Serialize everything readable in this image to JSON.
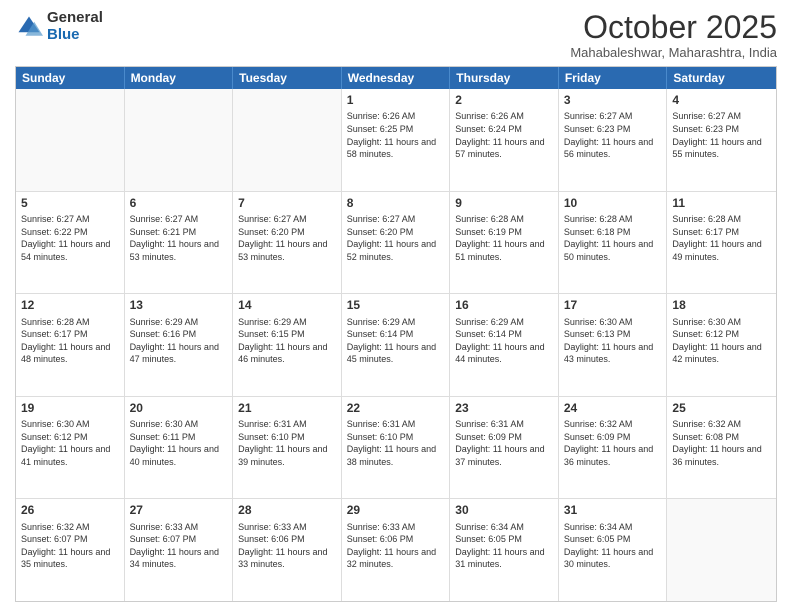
{
  "logo": {
    "general": "General",
    "blue": "Blue"
  },
  "title": "October 2025",
  "location": "Mahabaleshwar, Maharashtra, India",
  "headers": [
    "Sunday",
    "Monday",
    "Tuesday",
    "Wednesday",
    "Thursday",
    "Friday",
    "Saturday"
  ],
  "weeks": [
    [
      {
        "day": "",
        "sunrise": "",
        "sunset": "",
        "daylight": ""
      },
      {
        "day": "",
        "sunrise": "",
        "sunset": "",
        "daylight": ""
      },
      {
        "day": "",
        "sunrise": "",
        "sunset": "",
        "daylight": ""
      },
      {
        "day": "1",
        "sunrise": "Sunrise: 6:26 AM",
        "sunset": "Sunset: 6:25 PM",
        "daylight": "Daylight: 11 hours and 58 minutes."
      },
      {
        "day": "2",
        "sunrise": "Sunrise: 6:26 AM",
        "sunset": "Sunset: 6:24 PM",
        "daylight": "Daylight: 11 hours and 57 minutes."
      },
      {
        "day": "3",
        "sunrise": "Sunrise: 6:27 AM",
        "sunset": "Sunset: 6:23 PM",
        "daylight": "Daylight: 11 hours and 56 minutes."
      },
      {
        "day": "4",
        "sunrise": "Sunrise: 6:27 AM",
        "sunset": "Sunset: 6:23 PM",
        "daylight": "Daylight: 11 hours and 55 minutes."
      }
    ],
    [
      {
        "day": "5",
        "sunrise": "Sunrise: 6:27 AM",
        "sunset": "Sunset: 6:22 PM",
        "daylight": "Daylight: 11 hours and 54 minutes."
      },
      {
        "day": "6",
        "sunrise": "Sunrise: 6:27 AM",
        "sunset": "Sunset: 6:21 PM",
        "daylight": "Daylight: 11 hours and 53 minutes."
      },
      {
        "day": "7",
        "sunrise": "Sunrise: 6:27 AM",
        "sunset": "Sunset: 6:20 PM",
        "daylight": "Daylight: 11 hours and 53 minutes."
      },
      {
        "day": "8",
        "sunrise": "Sunrise: 6:27 AM",
        "sunset": "Sunset: 6:20 PM",
        "daylight": "Daylight: 11 hours and 52 minutes."
      },
      {
        "day": "9",
        "sunrise": "Sunrise: 6:28 AM",
        "sunset": "Sunset: 6:19 PM",
        "daylight": "Daylight: 11 hours and 51 minutes."
      },
      {
        "day": "10",
        "sunrise": "Sunrise: 6:28 AM",
        "sunset": "Sunset: 6:18 PM",
        "daylight": "Daylight: 11 hours and 50 minutes."
      },
      {
        "day": "11",
        "sunrise": "Sunrise: 6:28 AM",
        "sunset": "Sunset: 6:17 PM",
        "daylight": "Daylight: 11 hours and 49 minutes."
      }
    ],
    [
      {
        "day": "12",
        "sunrise": "Sunrise: 6:28 AM",
        "sunset": "Sunset: 6:17 PM",
        "daylight": "Daylight: 11 hours and 48 minutes."
      },
      {
        "day": "13",
        "sunrise": "Sunrise: 6:29 AM",
        "sunset": "Sunset: 6:16 PM",
        "daylight": "Daylight: 11 hours and 47 minutes."
      },
      {
        "day": "14",
        "sunrise": "Sunrise: 6:29 AM",
        "sunset": "Sunset: 6:15 PM",
        "daylight": "Daylight: 11 hours and 46 minutes."
      },
      {
        "day": "15",
        "sunrise": "Sunrise: 6:29 AM",
        "sunset": "Sunset: 6:14 PM",
        "daylight": "Daylight: 11 hours and 45 minutes."
      },
      {
        "day": "16",
        "sunrise": "Sunrise: 6:29 AM",
        "sunset": "Sunset: 6:14 PM",
        "daylight": "Daylight: 11 hours and 44 minutes."
      },
      {
        "day": "17",
        "sunrise": "Sunrise: 6:30 AM",
        "sunset": "Sunset: 6:13 PM",
        "daylight": "Daylight: 11 hours and 43 minutes."
      },
      {
        "day": "18",
        "sunrise": "Sunrise: 6:30 AM",
        "sunset": "Sunset: 6:12 PM",
        "daylight": "Daylight: 11 hours and 42 minutes."
      }
    ],
    [
      {
        "day": "19",
        "sunrise": "Sunrise: 6:30 AM",
        "sunset": "Sunset: 6:12 PM",
        "daylight": "Daylight: 11 hours and 41 minutes."
      },
      {
        "day": "20",
        "sunrise": "Sunrise: 6:30 AM",
        "sunset": "Sunset: 6:11 PM",
        "daylight": "Daylight: 11 hours and 40 minutes."
      },
      {
        "day": "21",
        "sunrise": "Sunrise: 6:31 AM",
        "sunset": "Sunset: 6:10 PM",
        "daylight": "Daylight: 11 hours and 39 minutes."
      },
      {
        "day": "22",
        "sunrise": "Sunrise: 6:31 AM",
        "sunset": "Sunset: 6:10 PM",
        "daylight": "Daylight: 11 hours and 38 minutes."
      },
      {
        "day": "23",
        "sunrise": "Sunrise: 6:31 AM",
        "sunset": "Sunset: 6:09 PM",
        "daylight": "Daylight: 11 hours and 37 minutes."
      },
      {
        "day": "24",
        "sunrise": "Sunrise: 6:32 AM",
        "sunset": "Sunset: 6:09 PM",
        "daylight": "Daylight: 11 hours and 36 minutes."
      },
      {
        "day": "25",
        "sunrise": "Sunrise: 6:32 AM",
        "sunset": "Sunset: 6:08 PM",
        "daylight": "Daylight: 11 hours and 36 minutes."
      }
    ],
    [
      {
        "day": "26",
        "sunrise": "Sunrise: 6:32 AM",
        "sunset": "Sunset: 6:07 PM",
        "daylight": "Daylight: 11 hours and 35 minutes."
      },
      {
        "day": "27",
        "sunrise": "Sunrise: 6:33 AM",
        "sunset": "Sunset: 6:07 PM",
        "daylight": "Daylight: 11 hours and 34 minutes."
      },
      {
        "day": "28",
        "sunrise": "Sunrise: 6:33 AM",
        "sunset": "Sunset: 6:06 PM",
        "daylight": "Daylight: 11 hours and 33 minutes."
      },
      {
        "day": "29",
        "sunrise": "Sunrise: 6:33 AM",
        "sunset": "Sunset: 6:06 PM",
        "daylight": "Daylight: 11 hours and 32 minutes."
      },
      {
        "day": "30",
        "sunrise": "Sunrise: 6:34 AM",
        "sunset": "Sunset: 6:05 PM",
        "daylight": "Daylight: 11 hours and 31 minutes."
      },
      {
        "day": "31",
        "sunrise": "Sunrise: 6:34 AM",
        "sunset": "Sunset: 6:05 PM",
        "daylight": "Daylight: 11 hours and 30 minutes."
      },
      {
        "day": "",
        "sunrise": "",
        "sunset": "",
        "daylight": ""
      }
    ]
  ]
}
